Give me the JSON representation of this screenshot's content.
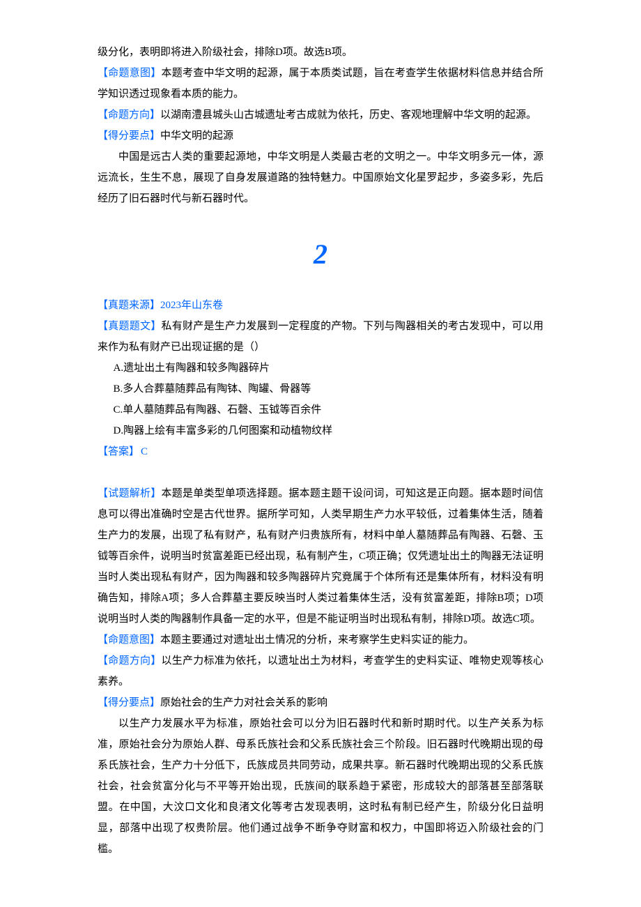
{
  "q1_tail": {
    "analysis_cont": "级分化，表明即将进入阶级社会，排除D项。故选B项。",
    "intent_label": "【命题意图】",
    "intent_text": "本题考查中华文明的起源，属于本质类试题，旨在考查学生依据材料信息并结合所学知识透过现象看本质的能力。",
    "direction_label": "【命题方向】",
    "direction_text": "以湖南澧县城头山古城遗址考古成就为依托，历史、客观地理解中华文明的起源。",
    "points_label": "【得分要点】",
    "points_title": "中华文明的起源",
    "points_body": "中国是远古人类的重要起源地，中华文明是人类最古老的文明之一。中华文明多元一体，源远流长，生生不息，展现了自身发展道路的独特魅力。中国原始文化星罗起步，多姿多彩，先后经历了旧石器时代与新石器时代。"
  },
  "sep_number": "2",
  "q2": {
    "source_label": "【真题来源】",
    "source_text": "2023年山东卷",
    "stem_label": "【真题题文】",
    "stem_text": "私有财产是生产力发展到一定程度的产物。下列与陶器相关的考古发现中，可以用来作为私有财产已出现证据的是（）",
    "options": {
      "a": "A.遗址出土有陶器和较多陶器碎片",
      "b": "B.多人合葬墓随葬品有陶钵、陶罐、骨器等",
      "c": "C.单人墓随葬品有陶器、石磬、玉钺等百余件",
      "d": "D.陶器上绘有丰富多彩的几何图案和动植物纹样"
    },
    "answer_label": "【答案】",
    "answer_text": "C",
    "analysis_label": "【试题解析】",
    "analysis_text": "本题是单类型单项选择题。据本题主题干设问词，可知这是正向题。据本题时间信息可以得出准确时空是古代世界。据所学可知，人类早期生产力水平较低，过着集体生活，随着生产力的发展，出现了私有财产，私有财产归贵族所有，材料中单人墓随葬品有陶器、石磬、玉钺等百余件，说明当时贫富差距已经出现，私有制产生，C项正确；仅凭遗址出土的陶器无法证明当时人类出现私有财产，因为陶器和较多陶器碎片究竟属于个体所有还是集体所有，材料没有明确告知，排除A项；多人合葬墓主要反映当时人类过着集体生活，没有贫富差距，排除B项；D项说明当时人类的陶器制作具备一定的水平，但是不能证明当时出现私有制，排除D项。故选C项。",
    "intent_label": "【命题意图】",
    "intent_text": "本题主要通过对遗址出土情况的分析，来考察学生史料实证的能力。",
    "direction_label": "【命题方向】",
    "direction_text": "以生产力标准为依托，以遗址出土为材料，考查学生的史料实证、唯物史观等核心素养。",
    "points_label": "【得分要点】",
    "points_title": "原始社会的生产力对社会关系的影响",
    "points_body": "以生产力发展水平为标准，原始社会可以分为旧石器时代和新时期时代。以生产关系为标准，原始社会分为原始人群、母系氏族社会和父系氏族社会三个阶段。旧石器时代晚期出现的母系氏族社会，生产力十分低下，氏族成员共同劳动，成果共享。新石器时代晚期出现的父系氏族社会，社会贫富分化与不平等开始出现，氏族间的联系趋于紧密，形成较大的部落甚至部落联盟。在中国，大汶口文化和良渚文化等考古发现表明，这时私有制已经产生，阶级分化日益明显，部落中出现了权贵阶层。他们通过战争不断争夺财富和权力，中国即将迈入阶级社会的门槛。"
  }
}
